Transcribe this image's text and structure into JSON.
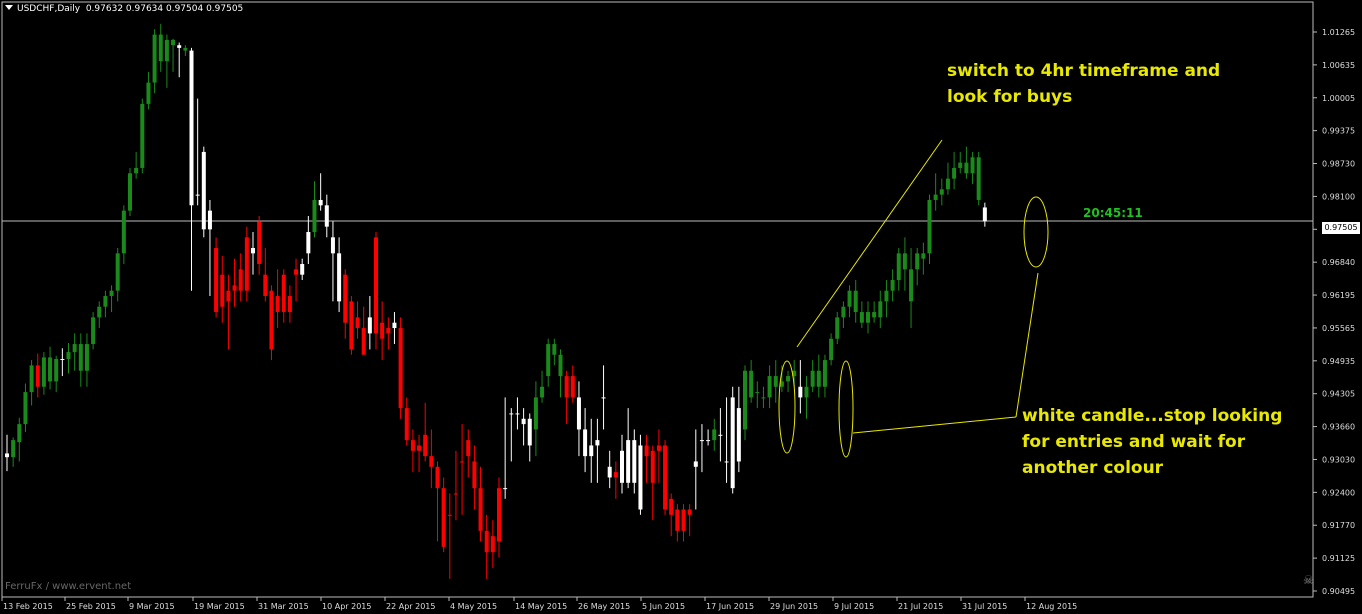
{
  "header": {
    "symbol": "USDCHF,Daily",
    "ohlc": "0.97632 0.97634 0.97504 0.97505"
  },
  "annotations": {
    "top_line1": "switch to 4hr timeframe and",
    "top_line2": "look for buys",
    "bottom_line1": "white candle...stop looking",
    "bottom_line2": "for entries and wait for",
    "bottom_line3": "another colour"
  },
  "timer": "20:45:11",
  "current_price_label": "0.97505",
  "watermark": "FerruFx / www.ervent.net",
  "colors": {
    "bull": "#1a8a1a",
    "bear": "#ff0000",
    "neutral": "#ffffff",
    "annotation": "#e8e800",
    "timer": "#22c022",
    "background": "#000000"
  },
  "chart_data": {
    "type": "candlestick",
    "price_axis_labels": [
      "1.01265",
      "1.00635",
      "1.00005",
      "0.99375",
      "0.98730",
      "0.98100",
      "0.97505",
      "0.96840",
      "0.96195",
      "0.95565",
      "0.94935",
      "0.94305",
      "0.93660",
      "0.93030",
      "0.92400",
      "0.91770",
      "0.91125",
      "0.90495"
    ],
    "date_axis_labels": [
      "13 Feb 2015",
      "25 Feb 2015",
      "9 Mar 2015",
      "19 Mar 2015",
      "31 Mar 2015",
      "10 Apr 2015",
      "22 Apr 2015",
      "4 May 2015",
      "14 May 2015",
      "26 May 2015",
      "5 Jun 2015",
      "17 Jun 2015",
      "29 Jun 2015",
      "9 Jul 2015",
      "21 Jul 2015",
      "31 Jul 2015",
      "12 Aug 2015"
    ],
    "ylim": [
      0.9046,
      1.0161
    ],
    "current_price": 0.97505,
    "candles": [
      [
        0.9315,
        0.935,
        0.9282,
        0.9308,
        "neutral"
      ],
      [
        0.9308,
        0.9345,
        0.929,
        0.934,
        "bull"
      ],
      [
        0.9336,
        0.9382,
        0.93,
        0.937,
        "bull"
      ],
      [
        0.937,
        0.9446,
        0.9355,
        0.943,
        "bull"
      ],
      [
        0.943,
        0.949,
        0.9405,
        0.948,
        "bull"
      ],
      [
        0.948,
        0.9502,
        0.942,
        0.944,
        "bear"
      ],
      [
        0.944,
        0.9505,
        0.9425,
        0.9495,
        "bull"
      ],
      [
        0.9495,
        0.9515,
        0.9435,
        0.945,
        "bull"
      ],
      [
        0.945,
        0.9498,
        0.943,
        0.9492,
        "bull"
      ],
      [
        0.9492,
        0.9512,
        0.946,
        0.9492,
        "neutral"
      ],
      [
        0.9492,
        0.9522,
        0.9465,
        0.9505,
        "bull"
      ],
      [
        0.9505,
        0.954,
        0.947,
        0.952,
        "bull"
      ],
      [
        0.952,
        0.954,
        0.944,
        0.947,
        "bull"
      ],
      [
        0.947,
        0.954,
        0.944,
        0.952,
        "bull"
      ],
      [
        0.952,
        0.958,
        0.951,
        0.957,
        "bull"
      ],
      [
        0.957,
        0.96,
        0.955,
        0.959,
        "bull"
      ],
      [
        0.959,
        0.962,
        0.957,
        0.961,
        "bull"
      ],
      [
        0.961,
        0.963,
        0.958,
        0.962,
        "bull"
      ],
      [
        0.962,
        0.97,
        0.96,
        0.969,
        "bull"
      ],
      [
        0.969,
        0.978,
        0.967,
        0.977,
        "bull"
      ],
      [
        0.977,
        0.985,
        0.976,
        0.984,
        "bull"
      ],
      [
        0.984,
        0.988,
        0.983,
        0.985,
        "bull"
      ],
      [
        0.985,
        0.998,
        0.984,
        0.997,
        "bull"
      ],
      [
        0.997,
        1.003,
        0.996,
        1.001,
        "bull"
      ],
      [
        1.001,
        1.011,
        0.999,
        1.01,
        "bull"
      ],
      [
        1.01,
        1.012,
        1.003,
        1.005,
        "bull"
      ],
      [
        1.005,
        1.01,
        1.0,
        1.009,
        "bull"
      ],
      [
        1.009,
        1.0092,
        1.003,
        1.008,
        "bull"
      ],
      [
        1.008,
        1.0085,
        1.002,
        1.0075,
        "neutral"
      ],
      [
        1.0075,
        1.008,
        1.006,
        1.007,
        "bull"
      ],
      [
        1.007,
        1.0075,
        0.962,
        0.978,
        "neutral"
      ],
      [
        0.98,
        0.998,
        0.978,
        0.98,
        "neutral"
      ],
      [
        0.988,
        0.989,
        0.972,
        0.9735,
        "neutral"
      ],
      [
        0.9735,
        0.979,
        0.961,
        0.977,
        "neutral"
      ],
      [
        0.97,
        0.972,
        0.957,
        0.958,
        "bear"
      ],
      [
        0.965,
        0.9685,
        0.956,
        0.959,
        "bear"
      ],
      [
        0.962,
        0.965,
        0.951,
        0.96,
        "bear"
      ],
      [
        0.963,
        0.968,
        0.959,
        0.962,
        "bear"
      ],
      [
        0.966,
        0.969,
        0.96,
        0.962,
        "bear"
      ],
      [
        0.972,
        0.974,
        0.96,
        0.962,
        "bear"
      ],
      [
        0.97,
        0.973,
        0.965,
        0.969,
        "neutral"
      ],
      [
        0.975,
        0.976,
        0.965,
        0.967,
        "bear"
      ],
      [
        0.965,
        0.97,
        0.96,
        0.961,
        "bear"
      ],
      [
        0.962,
        0.963,
        0.949,
        0.951,
        "bear"
      ],
      [
        0.961,
        0.966,
        0.955,
        0.958,
        "bear"
      ],
      [
        0.965,
        0.966,
        0.956,
        0.958,
        "bear"
      ],
      [
        0.961,
        0.963,
        0.956,
        0.958,
        "bear"
      ],
      [
        0.966,
        0.968,
        0.96,
        0.965,
        "bear"
      ],
      [
        0.965,
        0.968,
        0.964,
        0.967,
        "neutral"
      ],
      [
        0.969,
        0.976,
        0.967,
        0.973,
        "neutral"
      ],
      [
        0.973,
        0.9825,
        0.972,
        0.979,
        "bull"
      ],
      [
        0.979,
        0.984,
        0.977,
        0.978,
        "neutral"
      ],
      [
        0.978,
        0.98,
        0.972,
        0.974,
        "neutral"
      ],
      [
        0.972,
        0.975,
        0.96,
        0.969,
        "neutral"
      ],
      [
        0.969,
        0.972,
        0.958,
        0.96,
        "neutral"
      ],
      [
        0.965,
        0.966,
        0.953,
        0.956,
        "bear"
      ],
      [
        0.96,
        0.961,
        0.95,
        0.951,
        "bear"
      ],
      [
        0.957,
        0.96,
        0.953,
        0.955,
        "bear"
      ],
      [
        0.955,
        0.959,
        0.95,
        0.95,
        "bear"
      ],
      [
        0.957,
        0.961,
        0.951,
        0.954,
        "neutral"
      ],
      [
        0.972,
        0.973,
        0.951,
        0.954,
        "bear"
      ],
      [
        0.956,
        0.96,
        0.949,
        0.953,
        "bear"
      ],
      [
        0.955,
        0.957,
        0.951,
        0.954,
        "bear"
      ],
      [
        0.956,
        0.958,
        0.952,
        0.955,
        "neutral"
      ],
      [
        0.955,
        0.957,
        0.938,
        0.94,
        "bear"
      ],
      [
        0.94,
        0.942,
        0.933,
        0.934,
        "bear"
      ],
      [
        0.934,
        0.936,
        0.928,
        0.932,
        "bear"
      ],
      [
        0.933,
        0.935,
        0.928,
        0.932,
        "bear"
      ],
      [
        0.935,
        0.941,
        0.93,
        0.931,
        "bear"
      ],
      [
        0.931,
        0.936,
        0.925,
        0.929,
        "bear"
      ],
      [
        0.929,
        0.93,
        0.915,
        0.925,
        "bear"
      ],
      [
        0.925,
        0.927,
        0.913,
        0.914,
        "bear"
      ],
      [
        0.92,
        0.924,
        0.908,
        0.92,
        "bear"
      ],
      [
        0.924,
        0.932,
        0.919,
        0.924,
        "bear"
      ],
      [
        0.93,
        0.937,
        0.92,
        0.93,
        "bear"
      ],
      [
        0.934,
        0.936,
        0.927,
        0.931,
        "bear"
      ],
      [
        0.93,
        0.933,
        0.921,
        0.925,
        "bear"
      ],
      [
        0.925,
        0.929,
        0.915,
        0.917,
        "bear"
      ],
      [
        0.917,
        0.92,
        0.908,
        0.913,
        "bear"
      ],
      [
        0.913,
        0.919,
        0.91,
        0.916,
        "bear"
      ],
      [
        0.925,
        0.927,
        0.912,
        0.915,
        "bear"
      ],
      [
        0.925,
        0.942,
        0.923,
        0.925,
        "neutral"
      ],
      [
        0.939,
        0.94,
        0.93,
        0.939,
        "neutral"
      ],
      [
        0.939,
        0.942,
        0.936,
        0.939,
        "neutral"
      ],
      [
        0.938,
        0.94,
        0.933,
        0.937,
        "neutral"
      ],
      [
        0.938,
        0.939,
        0.93,
        0.933,
        "neutral"
      ],
      [
        0.936,
        0.945,
        0.931,
        0.942,
        "bull"
      ],
      [
        0.942,
        0.947,
        0.941,
        0.944,
        "bull"
      ],
      [
        0.946,
        0.953,
        0.944,
        0.952,
        "bull"
      ],
      [
        0.952,
        0.953,
        0.948,
        0.95,
        "bull"
      ],
      [
        0.95,
        0.951,
        0.942,
        0.946,
        "bull"
      ],
      [
        0.946,
        0.947,
        0.937,
        0.942,
        "bear"
      ],
      [
        0.946,
        0.948,
        0.941,
        0.942,
        "bear"
      ],
      [
        0.942,
        0.945,
        0.931,
        0.936,
        "neutral"
      ],
      [
        0.936,
        0.94,
        0.928,
        0.931,
        "neutral"
      ],
      [
        0.931,
        0.938,
        0.926,
        0.933,
        "neutral"
      ],
      [
        0.933,
        0.938,
        0.926,
        0.934,
        "neutral"
      ],
      [
        0.942,
        0.948,
        0.936,
        0.942,
        "neutral"
      ],
      [
        0.929,
        0.932,
        0.925,
        0.927,
        "neutral"
      ],
      [
        0.928,
        0.93,
        0.923,
        0.927,
        "bear"
      ],
      [
        0.932,
        0.935,
        0.924,
        0.926,
        "neutral"
      ],
      [
        0.934,
        0.94,
        0.925,
        0.926,
        "neutral"
      ],
      [
        0.934,
        0.936,
        0.924,
        0.926,
        "neutral"
      ],
      [
        0.933,
        0.935,
        0.92,
        0.921,
        "neutral"
      ],
      [
        0.933,
        0.935,
        0.926,
        0.931,
        "bear"
      ],
      [
        0.932,
        0.933,
        0.919,
        0.926,
        "bear"
      ],
      [
        0.932,
        0.936,
        0.926,
        0.933,
        "bear"
      ],
      [
        0.933,
        0.934,
        0.92,
        0.921,
        "bear"
      ],
      [
        0.923,
        0.924,
        0.916,
        0.92,
        "bear"
      ],
      [
        0.921,
        0.922,
        0.915,
        0.917,
        "bear"
      ],
      [
        0.921,
        0.922,
        0.915,
        0.917,
        "bear"
      ],
      [
        0.92,
        0.922,
        0.916,
        0.921,
        "bear"
      ],
      [
        0.929,
        0.936,
        0.921,
        0.93,
        "neutral"
      ],
      [
        0.934,
        0.937,
        0.928,
        0.934,
        "neutral"
      ],
      [
        0.934,
        0.936,
        0.933,
        0.934,
        "neutral"
      ],
      [
        0.934,
        0.938,
        0.932,
        0.936,
        "bull"
      ],
      [
        0.935,
        0.94,
        0.93,
        0.935,
        "neutral"
      ],
      [
        0.93,
        0.942,
        0.926,
        0.93,
        "neutral"
      ],
      [
        0.942,
        0.944,
        0.924,
        0.925,
        "neutral"
      ],
      [
        0.94,
        0.944,
        0.928,
        0.93,
        "neutral"
      ],
      [
        0.936,
        0.948,
        0.934,
        0.947,
        "bull"
      ],
      [
        0.947,
        0.949,
        0.941,
        0.942,
        "bull"
      ],
      [
        0.943,
        0.945,
        0.94,
        0.943,
        "bull"
      ],
      [
        0.942,
        0.944,
        0.94,
        0.942,
        "bull"
      ],
      [
        0.942,
        0.948,
        0.94,
        0.946,
        "bull"
      ],
      [
        0.946,
        0.949,
        0.941,
        0.944,
        "bull"
      ],
      [
        0.944,
        0.948,
        0.943,
        0.945,
        "bull"
      ],
      [
        0.945,
        0.947,
        0.943,
        0.946,
        "bull"
      ],
      [
        0.946,
        0.949,
        0.944,
        0.947,
        "bull"
      ],
      [
        0.944,
        0.949,
        0.939,
        0.942,
        "neutral"
      ],
      [
        0.942,
        0.946,
        0.938,
        0.944,
        "bull"
      ],
      [
        0.944,
        0.949,
        0.943,
        0.947,
        "bull"
      ],
      [
        0.947,
        0.95,
        0.942,
        0.944,
        "bull"
      ],
      [
        0.944,
        0.95,
        0.942,
        0.949,
        "bull"
      ],
      [
        0.949,
        0.954,
        0.948,
        0.953,
        "bull"
      ],
      [
        0.953,
        0.958,
        0.952,
        0.957,
        "bull"
      ],
      [
        0.957,
        0.96,
        0.955,
        0.959,
        "bull"
      ],
      [
        0.959,
        0.963,
        0.957,
        0.962,
        "bull"
      ],
      [
        0.962,
        0.964,
        0.956,
        0.958,
        "bull"
      ],
      [
        0.958,
        0.96,
        0.955,
        0.956,
        "bull"
      ],
      [
        0.956,
        0.96,
        0.954,
        0.958,
        "bull"
      ],
      [
        0.958,
        0.96,
        0.956,
        0.957,
        "bull"
      ],
      [
        0.957,
        0.962,
        0.955,
        0.96,
        "bull"
      ],
      [
        0.96,
        0.964,
        0.957,
        0.962,
        "bull"
      ],
      [
        0.962,
        0.966,
        0.96,
        0.964,
        "bull"
      ],
      [
        0.964,
        0.97,
        0.962,
        0.969,
        "bull"
      ],
      [
        0.969,
        0.972,
        0.962,
        0.966,
        "bull"
      ],
      [
        0.966,
        0.97,
        0.955,
        0.96,
        "bull"
      ],
      [
        0.966,
        0.97,
        0.963,
        0.969,
        "bull"
      ],
      [
        0.969,
        0.971,
        0.965,
        0.968,
        "bull"
      ],
      [
        0.969,
        0.98,
        0.967,
        0.979,
        "bull"
      ],
      [
        0.979,
        0.984,
        0.977,
        0.98,
        "bull"
      ],
      [
        0.98,
        0.983,
        0.978,
        0.981,
        "bull"
      ],
      [
        0.981,
        0.986,
        0.98,
        0.983,
        "bull"
      ],
      [
        0.983,
        0.988,
        0.981,
        0.985,
        "bull"
      ],
      [
        0.985,
        0.988,
        0.984,
        0.986,
        "bull"
      ],
      [
        0.986,
        0.989,
        0.983,
        0.984,
        "bull"
      ],
      [
        0.984,
        0.988,
        0.982,
        0.987,
        "bull"
      ],
      [
        0.987,
        0.988,
        0.978,
        0.979,
        "bull"
      ],
      [
        0.9776,
        0.9785,
        0.974,
        0.975,
        "neutral"
      ]
    ]
  }
}
